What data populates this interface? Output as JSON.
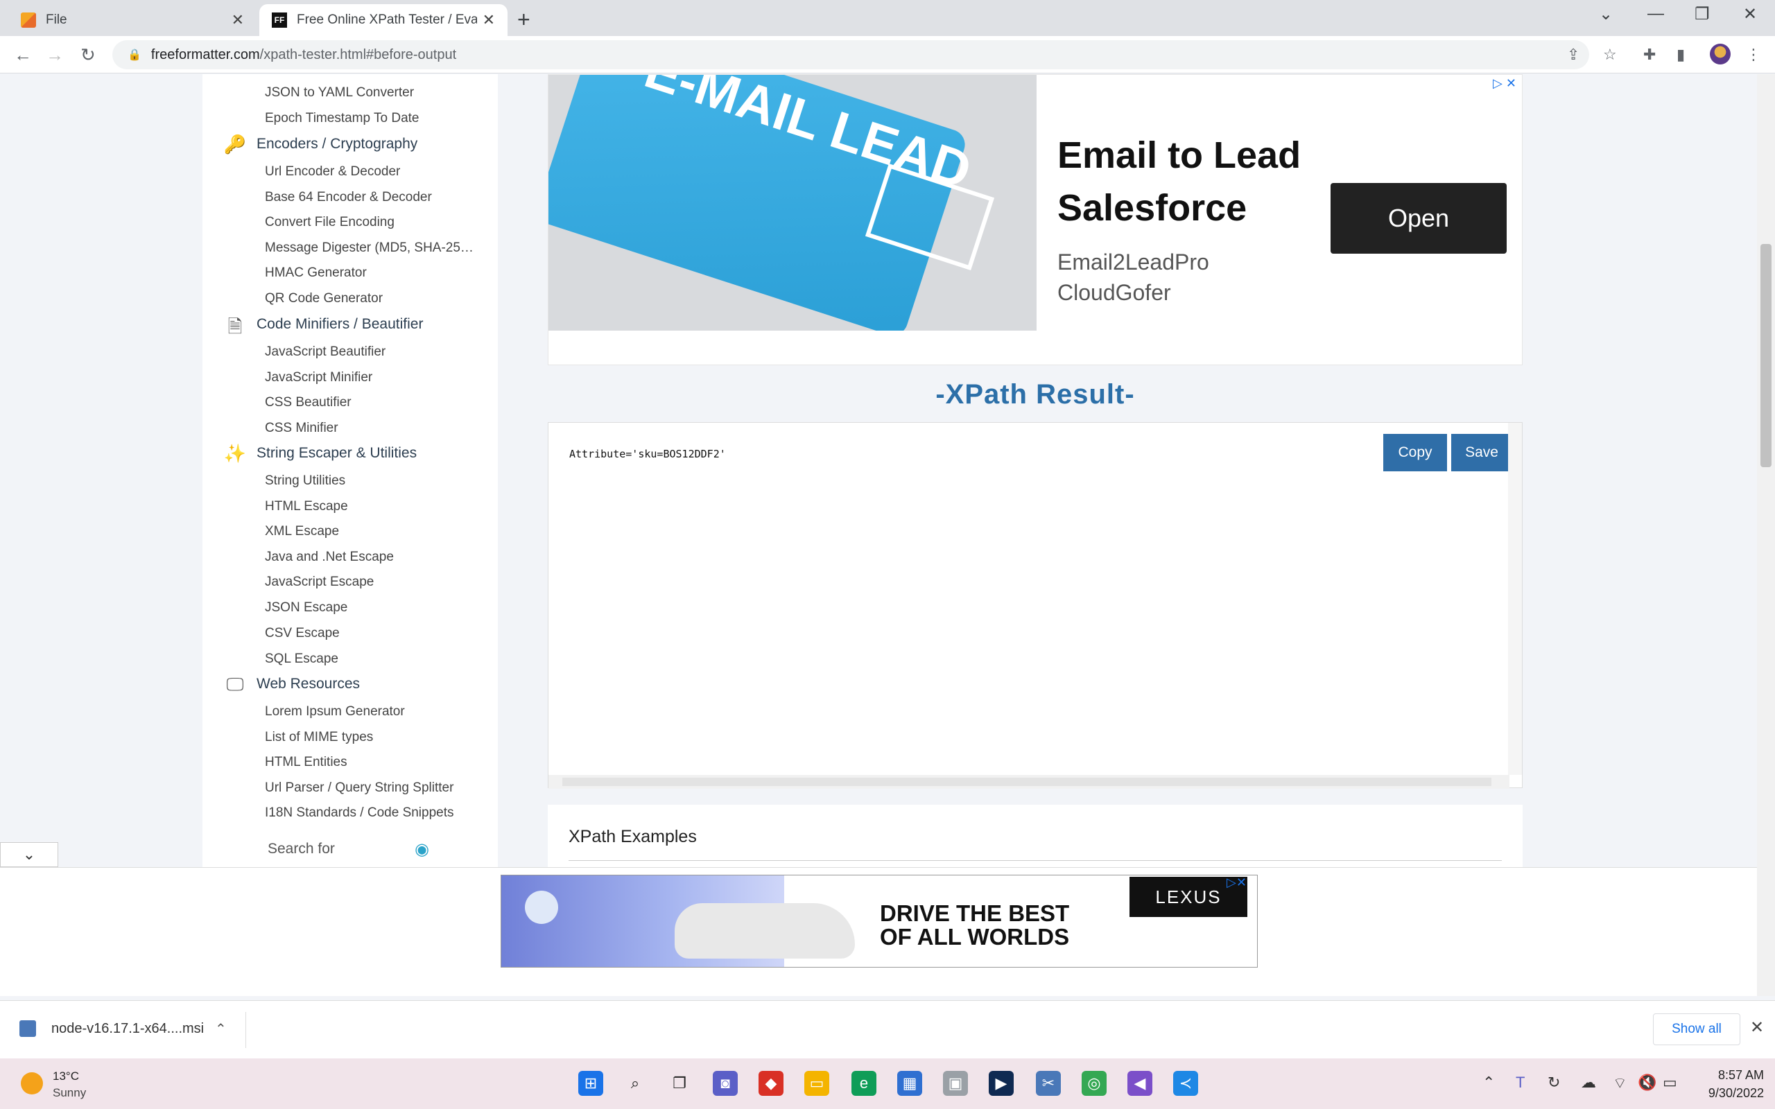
{
  "browser": {
    "tabs": [
      {
        "label": "File"
      },
      {
        "label": "Free Online XPath Tester / Evaluator"
      }
    ],
    "url_host": "freeformatter.com",
    "url_path": "/xpath-tester.html#before-output"
  },
  "sidebar": {
    "top_links": [
      "JSON to YAML Converter",
      "Epoch Timestamp To Date"
    ],
    "categories": [
      {
        "title": "Encoders / Cryptography",
        "icon": "key-icon",
        "links": [
          "Url Encoder & Decoder",
          "Base 64 Encoder & Decoder",
          "Convert File Encoding",
          "Message Digester (MD5, SHA-25…",
          "HMAC Generator",
          "QR Code Generator"
        ]
      },
      {
        "title": "Code Minifiers / Beautifier",
        "icon": "file-zip-icon",
        "links": [
          "JavaScript Beautifier",
          "JavaScript Minifier",
          "CSS Beautifier",
          "CSS Minifier"
        ]
      },
      {
        "title": "String Escaper & Utilities",
        "icon": "magic-wand-icon",
        "links": [
          "String Utilities",
          "HTML Escape",
          "XML Escape",
          "Java and .Net Escape",
          "JavaScript Escape",
          "JSON Escape",
          "CSV Escape",
          "SQL Escape"
        ]
      },
      {
        "title": "Web Resources",
        "icon": "monitor-code-icon",
        "links": [
          "Lorem Ipsum Generator",
          "List of MIME types",
          "HTML Entities",
          "Url Parser / Query String Splitter",
          "I18N Standards / Code Snippets"
        ]
      }
    ],
    "search_placeholder": "Search for"
  },
  "ad": {
    "keycap_text": "E-MAIL LEAD",
    "title": "Email to Lead Salesforce",
    "sub1": "Email2LeadPro",
    "sub2": "CloudGofer",
    "button": "Open"
  },
  "result": {
    "heading": "-XPath Result-",
    "output": "Attribute='sku=BOS12DDF2'",
    "copy_label": "Copy",
    "save_label": "Save"
  },
  "examples": {
    "heading": "XPath Examples"
  },
  "bottom_ad": {
    "slogan_line1": "DRIVE THE BEST",
    "slogan_line2": "OF ALL WORLDS",
    "brand": "LEXUS"
  },
  "downloads": {
    "file": "node-v16.17.1-x64....msi",
    "show_all": "Show all"
  },
  "taskbar": {
    "temperature": "13°C",
    "weather": "Sunny",
    "time": "8:57 AM",
    "date": "9/30/2022"
  }
}
